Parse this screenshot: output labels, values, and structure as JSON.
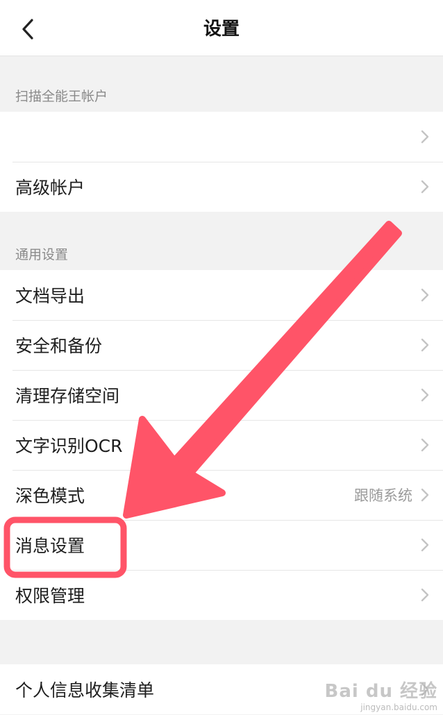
{
  "header": {
    "title": "设置",
    "back_icon": "chevron-left-icon"
  },
  "sections": {
    "account": {
      "label": "扫描全能王帐户",
      "items": [
        {
          "label": "",
          "value": ""
        },
        {
          "label": "高级帐户",
          "value": ""
        }
      ]
    },
    "general": {
      "label": "通用设置",
      "items": [
        {
          "label": "文档导出",
          "value": ""
        },
        {
          "label": "安全和备份",
          "value": ""
        },
        {
          "label": "清理存储空间",
          "value": ""
        },
        {
          "label": "文字识别OCR",
          "value": ""
        },
        {
          "label": "深色模式",
          "value": "跟随系统"
        },
        {
          "label": "消息设置",
          "value": ""
        },
        {
          "label": "权限管理",
          "value": ""
        }
      ]
    },
    "privacy": {
      "items": [
        {
          "label": "个人信息收集清单",
          "value": ""
        }
      ]
    }
  },
  "annotation": {
    "arrow_color": "#ff5468",
    "highlight_target": "消息设置"
  },
  "watermark": {
    "brand": "Bai du 经验",
    "url": "jingyan.baidu.com"
  }
}
